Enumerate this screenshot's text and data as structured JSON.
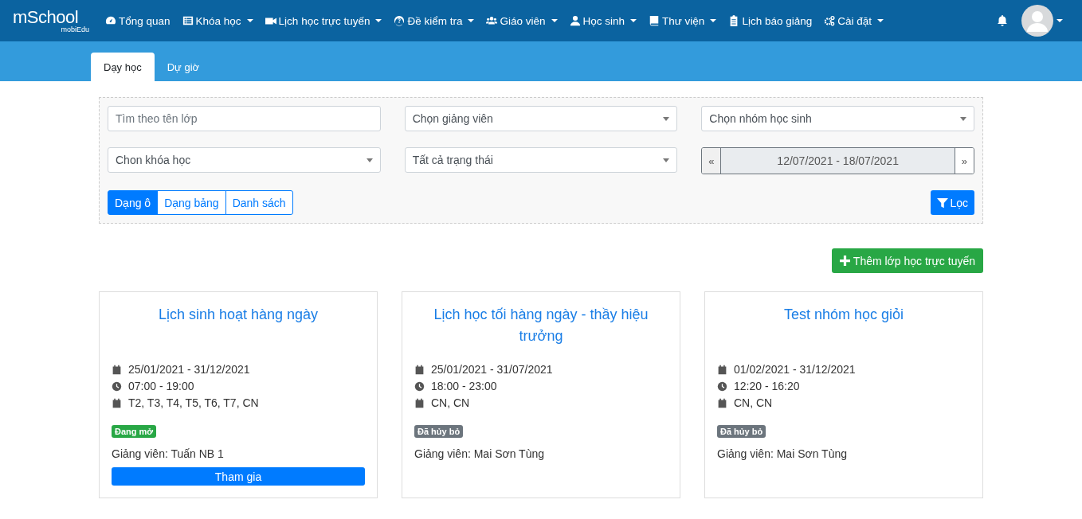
{
  "brand": {
    "logo_main": "mSchool",
    "logo_sub": "mobiEdu"
  },
  "nav": [
    {
      "label": "Tổng quan",
      "dropdown": false
    },
    {
      "label": "Khóa học",
      "dropdown": true
    },
    {
      "label": "Lịch học trực tuyến",
      "dropdown": true
    },
    {
      "label": "Đề kiểm tra",
      "dropdown": true
    },
    {
      "label": "Giáo viên",
      "dropdown": true
    },
    {
      "label": "Học sinh",
      "dropdown": true
    },
    {
      "label": "Thư viện",
      "dropdown": true
    },
    {
      "label": "Lịch báo giảng",
      "dropdown": false
    },
    {
      "label": "Cài đặt",
      "dropdown": true
    }
  ],
  "tabs": [
    {
      "label": "Dạy học",
      "selected": true
    },
    {
      "label": "Dự giờ",
      "selected": false
    }
  ],
  "filters": [
    {
      "kind": "text",
      "placeholder": "Tìm theo tên lớp"
    },
    {
      "kind": "select",
      "value": "Chọn giảng viên"
    },
    {
      "kind": "select",
      "value": "Chọn nhóm học sinh"
    },
    {
      "kind": "select",
      "value": "Chon khóa học"
    },
    {
      "kind": "select",
      "value": "Tất cả trạng thái"
    },
    {
      "kind": "range",
      "prev": "«",
      "value": "12/07/2021 - 18/07/2021",
      "next": "»"
    }
  ],
  "views": [
    {
      "label": "Dạng ô",
      "selected": true
    },
    {
      "label": "Dạng bảng",
      "selected": false
    },
    {
      "label": "Danh sách",
      "selected": false
    }
  ],
  "filter_button": "Lọc",
  "add_button": "Thêm lớp học trực tuyến",
  "cards": [
    {
      "title": "Lịch sinh hoạt hàng ngày",
      "dates": "25/01/2021 - 31/12/2021",
      "time": "07:00 - 19:00",
      "days": "T2, T3, T4, T5, T6, T7, CN",
      "status": "Đang mở",
      "kind": "open",
      "teacher": "Giảng viên: Tuấn NB 1",
      "join": "Tham gia"
    },
    {
      "title": "Lịch học tối hàng ngày - thầy hiệu trưởng",
      "dates": "25/01/2021 - 31/07/2021",
      "time": "18:00 - 23:00",
      "days": "CN, CN",
      "status": "Đã hủy bỏ",
      "kind": "cancelled",
      "teacher": "Giảng viên: Mai Sơn Tùng"
    },
    {
      "title": "Test nhóm học giỏi",
      "dates": "01/02/2021 - 31/12/2021",
      "time": "12:20 - 16:20",
      "days": "CN, CN",
      "status": "Đã hủy bỏ",
      "kind": "cancelled",
      "teacher": "Giảng viên: Mai Sơn Tùng"
    }
  ]
}
